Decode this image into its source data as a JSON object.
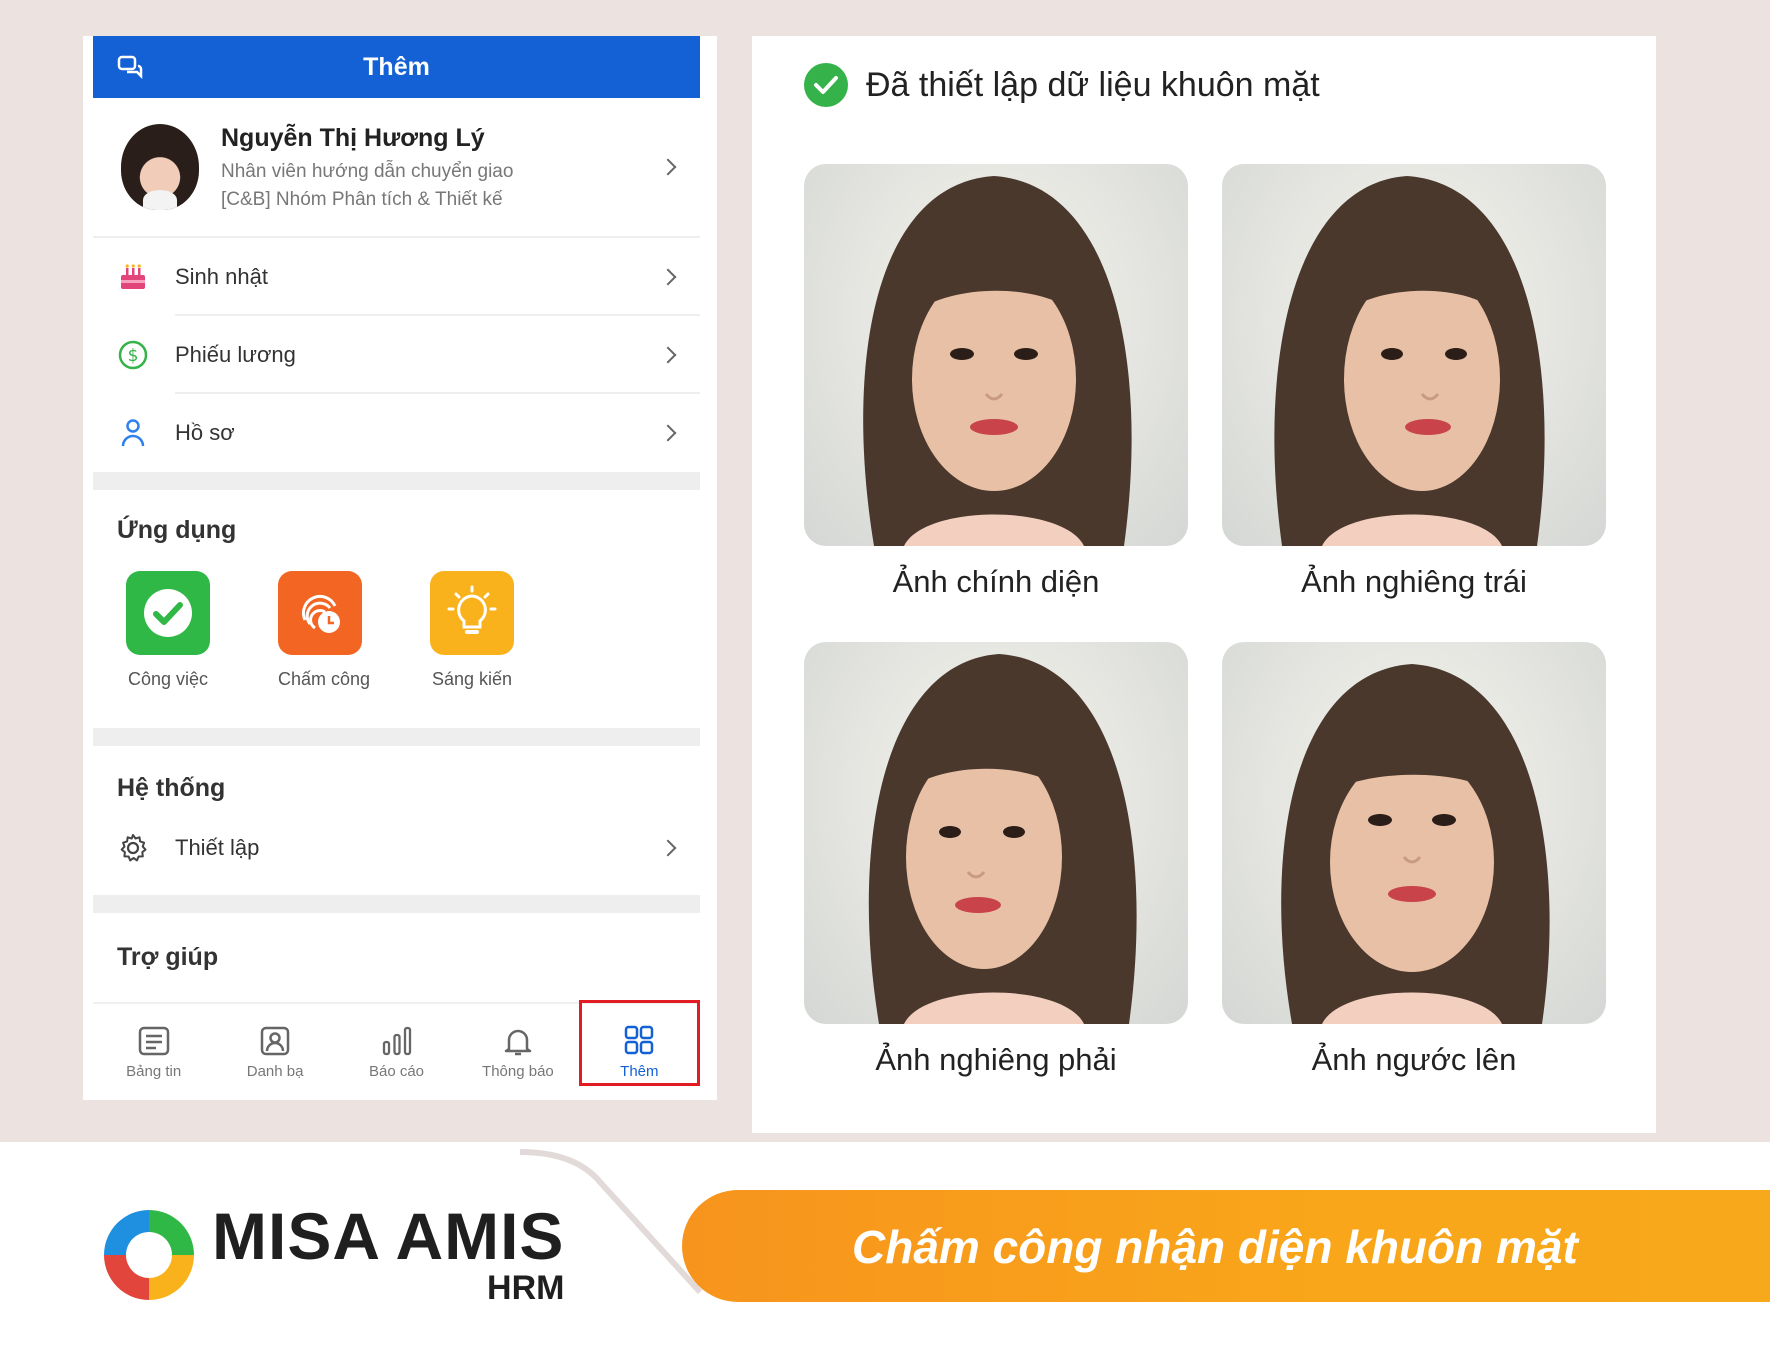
{
  "phone": {
    "header_title": "Thêm",
    "profile": {
      "name": "Nguyễn Thị Hương Lý",
      "position": "Nhân viên hướng dẫn chuyển giao",
      "department": "[C&B] Nhóm Phân tích & Thiết kế"
    },
    "menu": [
      {
        "label": "Sinh nhật",
        "icon": "birthday-cake-icon"
      },
      {
        "label": "Phiếu lương",
        "icon": "dollar-circle-icon"
      },
      {
        "label": "Hồ sơ",
        "icon": "person-icon"
      }
    ],
    "apps_section": {
      "title": "Ứng dụng",
      "apps": [
        {
          "label": "Công việc",
          "icon": "check-icon",
          "color": "#2fb845"
        },
        {
          "label": "Chấm công",
          "icon": "fingerprint-clock-icon",
          "color": "#f26522"
        },
        {
          "label": "Sáng kiến",
          "icon": "lightbulb-icon",
          "color": "#f9b21b"
        }
      ]
    },
    "system_section": {
      "title": "Hệ thống",
      "settings_label": "Thiết lập"
    },
    "help_section": {
      "title": "Trợ giúp"
    },
    "tabs": [
      {
        "label": "Bảng tin",
        "icon": "newsfeed-icon"
      },
      {
        "label": "Danh bạ",
        "icon": "contacts-icon"
      },
      {
        "label": "Báo cáo",
        "icon": "report-chart-icon"
      },
      {
        "label": "Thông báo",
        "icon": "bell-icon"
      },
      {
        "label": "Thêm",
        "icon": "grid-icon",
        "active": true
      }
    ],
    "accent_color": "#1361d4"
  },
  "face_data": {
    "title": "Đã thiết lập dữ liệu khuôn mặt",
    "photos": [
      {
        "caption": "Ảnh chính diện"
      },
      {
        "caption": "Ảnh nghiêng trái"
      },
      {
        "caption": "Ảnh nghiêng phải"
      },
      {
        "caption": "Ảnh ngước lên"
      }
    ]
  },
  "branding": {
    "logo_main": "MISA AMIS",
    "logo_sub": "HRM",
    "tagline": "Chấm công nhận diện khuôn mặt",
    "banner_color": "#f7941d"
  }
}
